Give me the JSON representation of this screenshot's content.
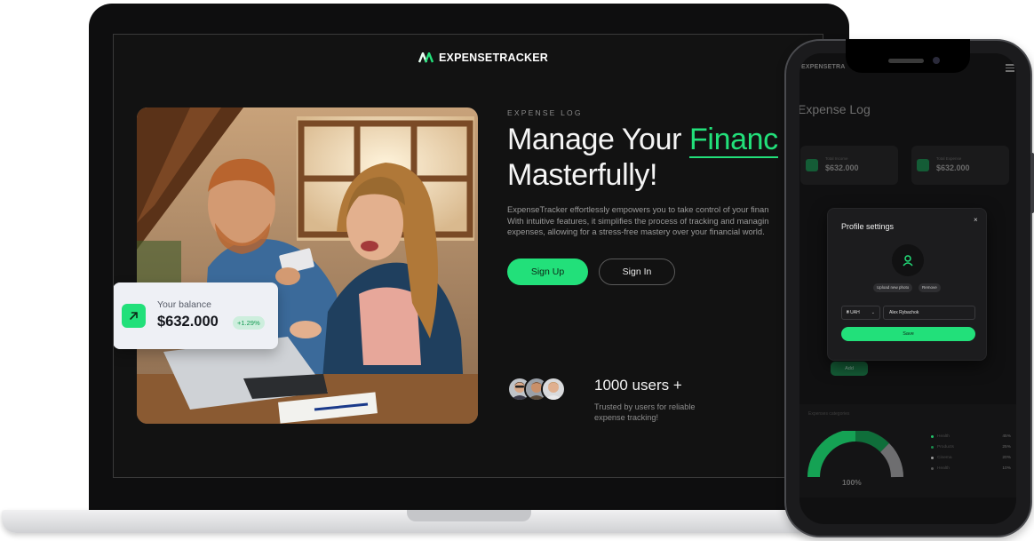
{
  "laptop": {
    "logo_text": "EXPENSETRACKER",
    "eyebrow": "EXPENSE LOG",
    "headline_part1": "Manage Your ",
    "headline_accent": "Financ",
    "headline_part2": "Masterfully!",
    "description_lines": [
      "ExpenseTracker effortlessly empowers you to take control of your finan",
      "With intuitive features, it simplifies the process of tracking and managin",
      "expenses, allowing for a stress-free mastery over your financial world."
    ],
    "signup_label": "Sign Up",
    "signin_label": "Sign In",
    "balance": {
      "label": "Your balance",
      "value": "$632.000",
      "delta": "+1.29%"
    },
    "users_count": "1000 users +",
    "users_caption": "Trusted by users for reliable expense tracking!"
  },
  "phone": {
    "logo_text": "EXPENSETRA",
    "title": "Expense Log",
    "stat_cards": [
      {
        "label": "Total Income",
        "value": "$632.000"
      },
      {
        "label": "Total Expense",
        "value": "$632.000"
      }
    ],
    "add_label": "Add",
    "chart_title": "Expenses categories",
    "gauge_label": "100%",
    "legend": [
      {
        "name": "Health",
        "pct": "45%",
        "color": "#22c46a"
      },
      {
        "name": "Products",
        "pct": "25%",
        "color": "#1a8a4c"
      },
      {
        "name": "Cinema",
        "pct": "20%",
        "color": "#9a9a9a"
      },
      {
        "name": "Health",
        "pct": "10%",
        "color": "#555555"
      }
    ],
    "modal": {
      "title": "Profile settings",
      "close": "×",
      "upload_label": "Upload new photo",
      "remove_label": "Remove",
      "currency": "₴ UAH",
      "name_value": "Alex Rybachok",
      "save_label": "Save"
    }
  },
  "colors": {
    "accent": "#22e07a",
    "background": "#121212",
    "card": "#eef0f5"
  }
}
